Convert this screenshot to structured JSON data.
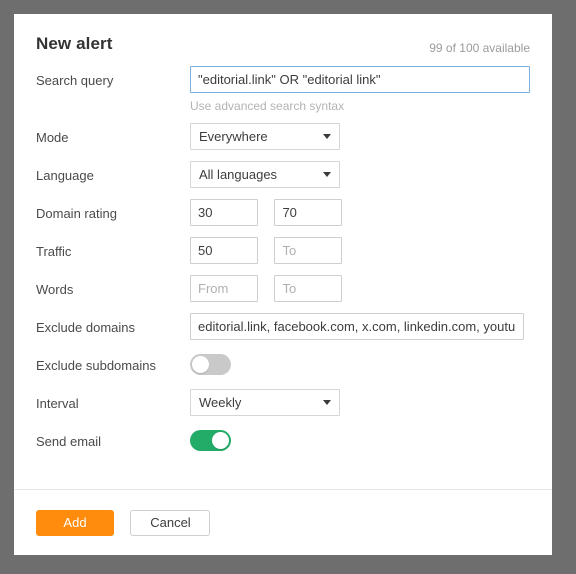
{
  "dialog": {
    "title": "New alert",
    "quota": "99 of 100 available"
  },
  "fields": {
    "search_query": {
      "label": "Search query",
      "value": "\"editorial.link\" OR \"editorial link\"",
      "placeholder": "",
      "helper": "Use advanced search syntax",
      "focused": true
    },
    "mode": {
      "label": "Mode",
      "value": "Everywhere"
    },
    "language": {
      "label": "Language",
      "value": "All languages"
    },
    "domain_rating": {
      "label": "Domain rating",
      "from_value": "30",
      "from_placeholder": "From",
      "to_value": "70",
      "to_placeholder": "To"
    },
    "traffic": {
      "label": "Traffic",
      "from_value": "50",
      "from_placeholder": "From",
      "to_value": "",
      "to_placeholder": "To"
    },
    "words": {
      "label": "Words",
      "from_value": "",
      "from_placeholder": "From",
      "to_value": "",
      "to_placeholder": "To"
    },
    "exclude_domains": {
      "label": "Exclude domains",
      "value": "editorial.link, facebook.com, x.com, linkedin.com, youtube.",
      "placeholder": ""
    },
    "exclude_subdomains": {
      "label": "Exclude subdomains",
      "state": "off"
    },
    "interval": {
      "label": "Interval",
      "value": "Weekly"
    },
    "send_email": {
      "label": "Send email",
      "state": "on"
    }
  },
  "footer": {
    "submit_label": "Add",
    "cancel_label": "Cancel"
  },
  "colors": {
    "accent_orange": "#ff8c0d",
    "toggle_on_green": "#23ac68",
    "toggle_off_gray": "#c9c9c9",
    "focus_blue": "#7cb0e0",
    "backdrop": "#6e6e6e"
  }
}
